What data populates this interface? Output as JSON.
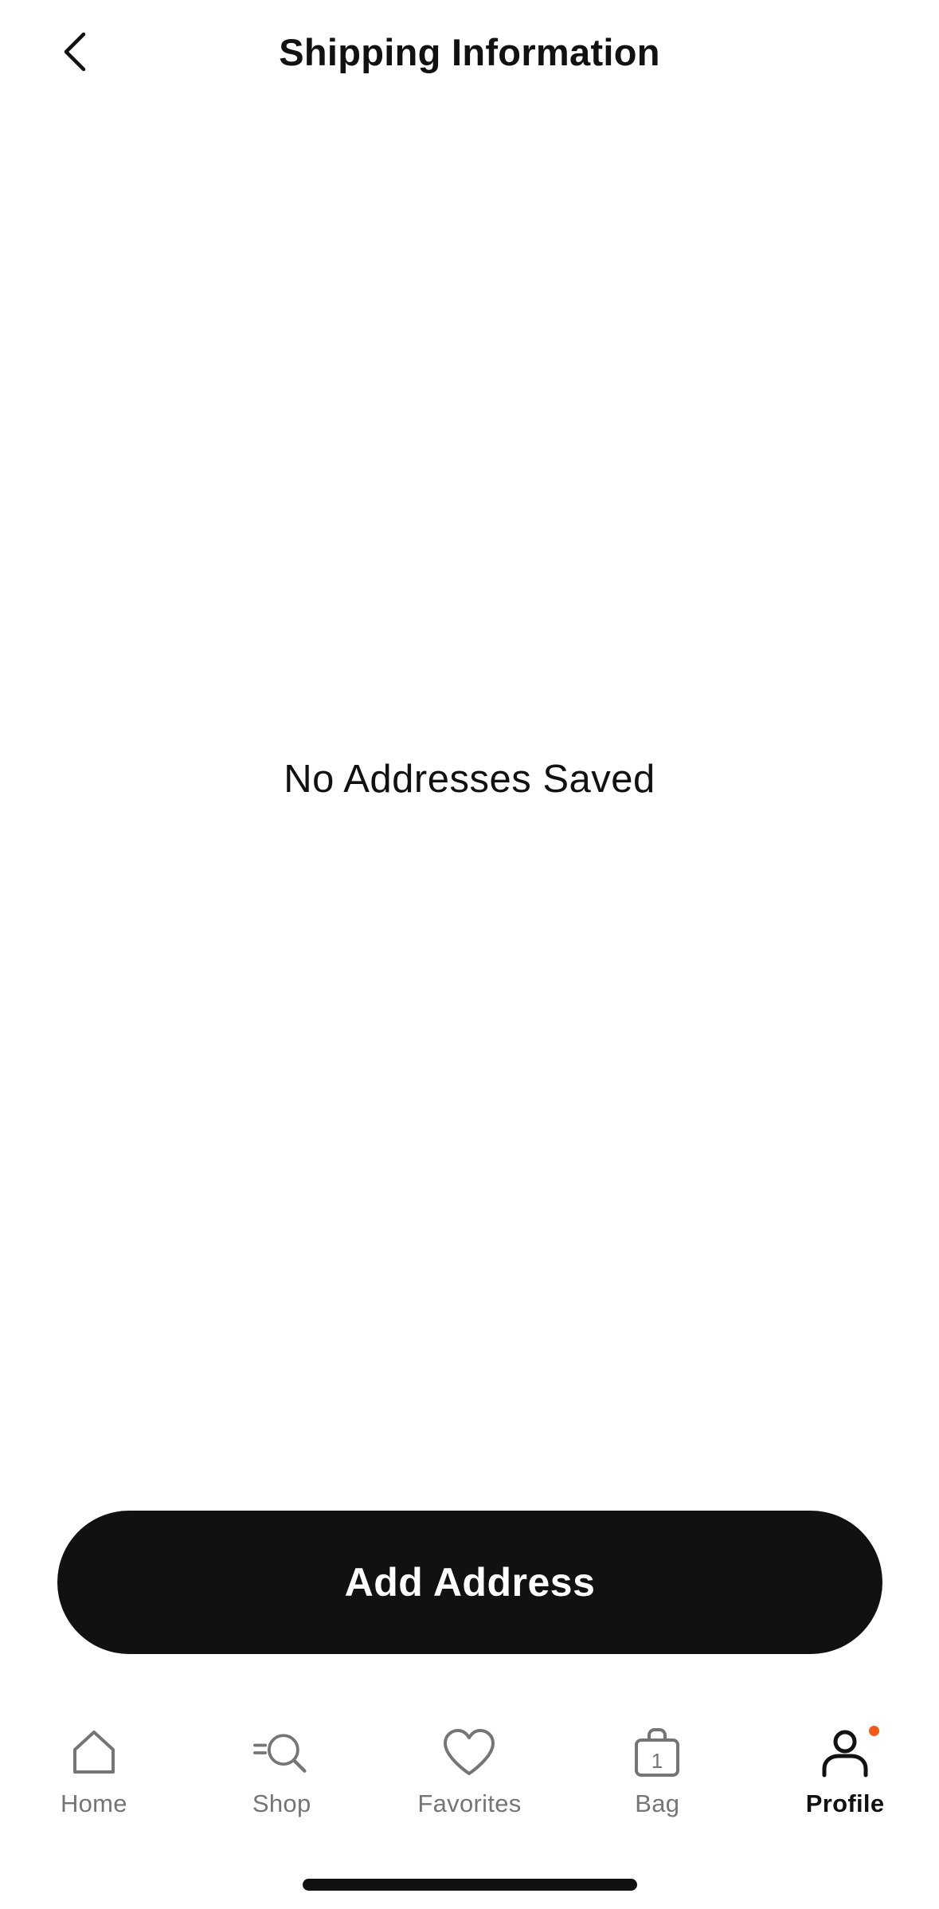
{
  "header": {
    "title": "Shipping Information",
    "back_icon": "chevron-left-icon"
  },
  "empty_state": {
    "message": "No Addresses Saved"
  },
  "actions": {
    "add_address_label": "Add Address"
  },
  "tab_bar": {
    "active": "Profile",
    "items": [
      {
        "label": "Home",
        "icon": "home-icon"
      },
      {
        "label": "Shop",
        "icon": "shop-search-icon"
      },
      {
        "label": "Favorites",
        "icon": "heart-icon"
      },
      {
        "label": "Bag",
        "icon": "bag-icon",
        "badge_count": "1"
      },
      {
        "label": "Profile",
        "icon": "profile-icon",
        "has_notification": true
      }
    ]
  },
  "colors": {
    "primary": "#111111",
    "inactive": "#757575",
    "notification": "#f25a1a",
    "background": "#ffffff"
  }
}
